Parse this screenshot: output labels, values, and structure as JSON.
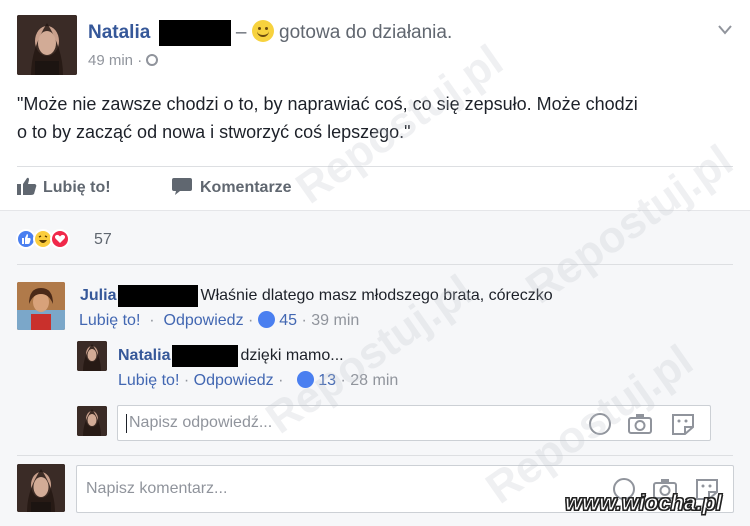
{
  "post": {
    "author_name": "Natalia",
    "feeling_text": "gotowa do działania.",
    "timestamp": "49 min",
    "text_line1": "\"Może nie zawsze chodzi o to, by naprawiać coś, co się zepsuło. Może chodzi",
    "text_line2": "o to by zacząć od nowa i stworzyć coś lepszego.\""
  },
  "actions": {
    "like_label": "Lubię to!",
    "comment_label": "Komentarze"
  },
  "reactions": {
    "count": "57",
    "icons": [
      "like-icon",
      "haha-icon",
      "love-icon"
    ]
  },
  "comments": [
    {
      "author_name": "Julia",
      "text": "Właśnie dlatego masz młodszego brata, córeczko",
      "like_label": "Lubię to!",
      "reply_label": "Odpowiedz",
      "like_count": "45",
      "time": "39 min"
    },
    {
      "author_name": "Natalia",
      "text": "dzięki mamo...",
      "like_label": "Lubię to!",
      "reply_label": "Odpowiedz",
      "like_count": "13",
      "time": "28 min"
    }
  ],
  "reply_input": {
    "placeholder": "Napisz odpowiedź..."
  },
  "comment_input": {
    "placeholder": "Napisz komentarz..."
  },
  "watermark": {
    "site": "www.wiocha.pl",
    "repeat": "Repostuj.pl"
  },
  "colors": {
    "link": "#4267b2",
    "name": "#365899",
    "love": "#f0284a",
    "haha": "#fbcd3d"
  }
}
